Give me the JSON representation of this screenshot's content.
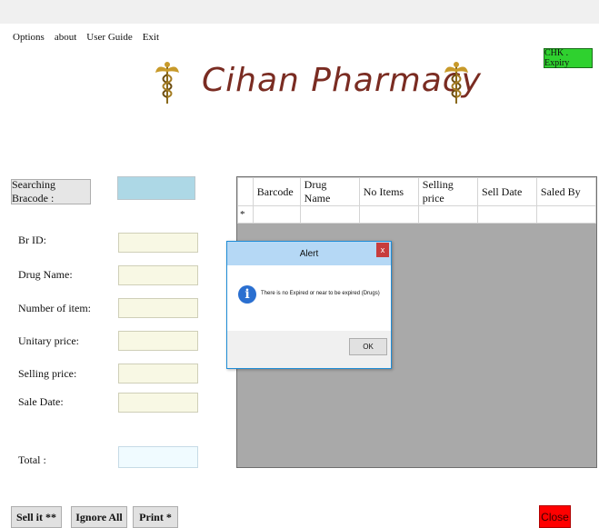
{
  "menu": [
    "Options",
    "about",
    "User Guide",
    "Exit"
  ],
  "app_title": "Cihan Pharmacy",
  "chk_expiry_label": "CHK . Expiry",
  "search": {
    "label": "Searching Bracode :",
    "value": ""
  },
  "fields": [
    {
      "label": "Br ID:"
    },
    {
      "label": "Drug Name:"
    },
    {
      "label": "Number of item:"
    },
    {
      "label": "Unitary price:"
    },
    {
      "label": "Selling price:"
    },
    {
      "label": "Sale Date:"
    }
  ],
  "total_label": "Total :",
  "grid": {
    "columns": [
      "Barcode",
      "Drug Name",
      "No Items",
      "Selling price",
      "Sell Date",
      "Saled By"
    ],
    "new_row_marker": "*"
  },
  "dialog": {
    "title": "Alert",
    "close_label": "x",
    "message": "There is no Expired or near to be expired (Drugs)",
    "ok_label": "OK"
  },
  "buttons": {
    "sell": "Sell it **",
    "ignore": "Ignore All",
    "print": "Print *",
    "close": "Close"
  },
  "colors": {
    "title": "#7a2c22",
    "chk_button": "#2fd12f",
    "close_button": "#ff0000",
    "search_input": "#add8e6",
    "grid_background": "#a9a9a9"
  },
  "icons": {
    "logo": "caduceus-icon",
    "dialog": "info-icon"
  }
}
